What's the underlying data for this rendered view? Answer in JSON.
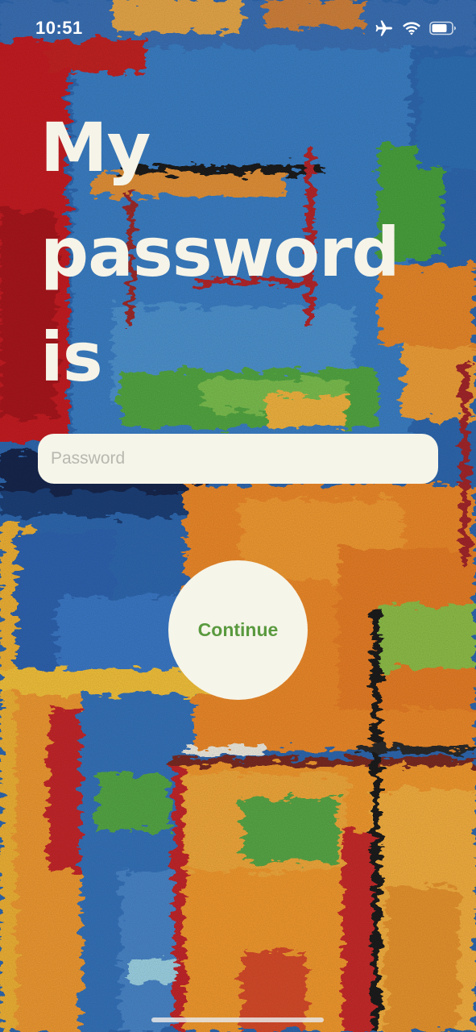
{
  "status_bar": {
    "time": "10:51",
    "icons": [
      "airplane-mode-icon",
      "wifi-icon",
      "battery-icon"
    ],
    "text_color": "#ffffff"
  },
  "headline": {
    "text": "My password is",
    "color": "#f6f4e8"
  },
  "password_input": {
    "value": "",
    "placeholder": "Password",
    "background": "#f6f5ea"
  },
  "continue_button": {
    "label": "Continue",
    "label_color": "#5a9a3f",
    "background": "#f6f5ea"
  },
  "background": {
    "description_icon": "abstract-painting-background",
    "colors": [
      "#c41d1d",
      "#2a5fa8",
      "#f08a24",
      "#3c9a3a",
      "#f3c02f",
      "#1a1a1a"
    ]
  }
}
